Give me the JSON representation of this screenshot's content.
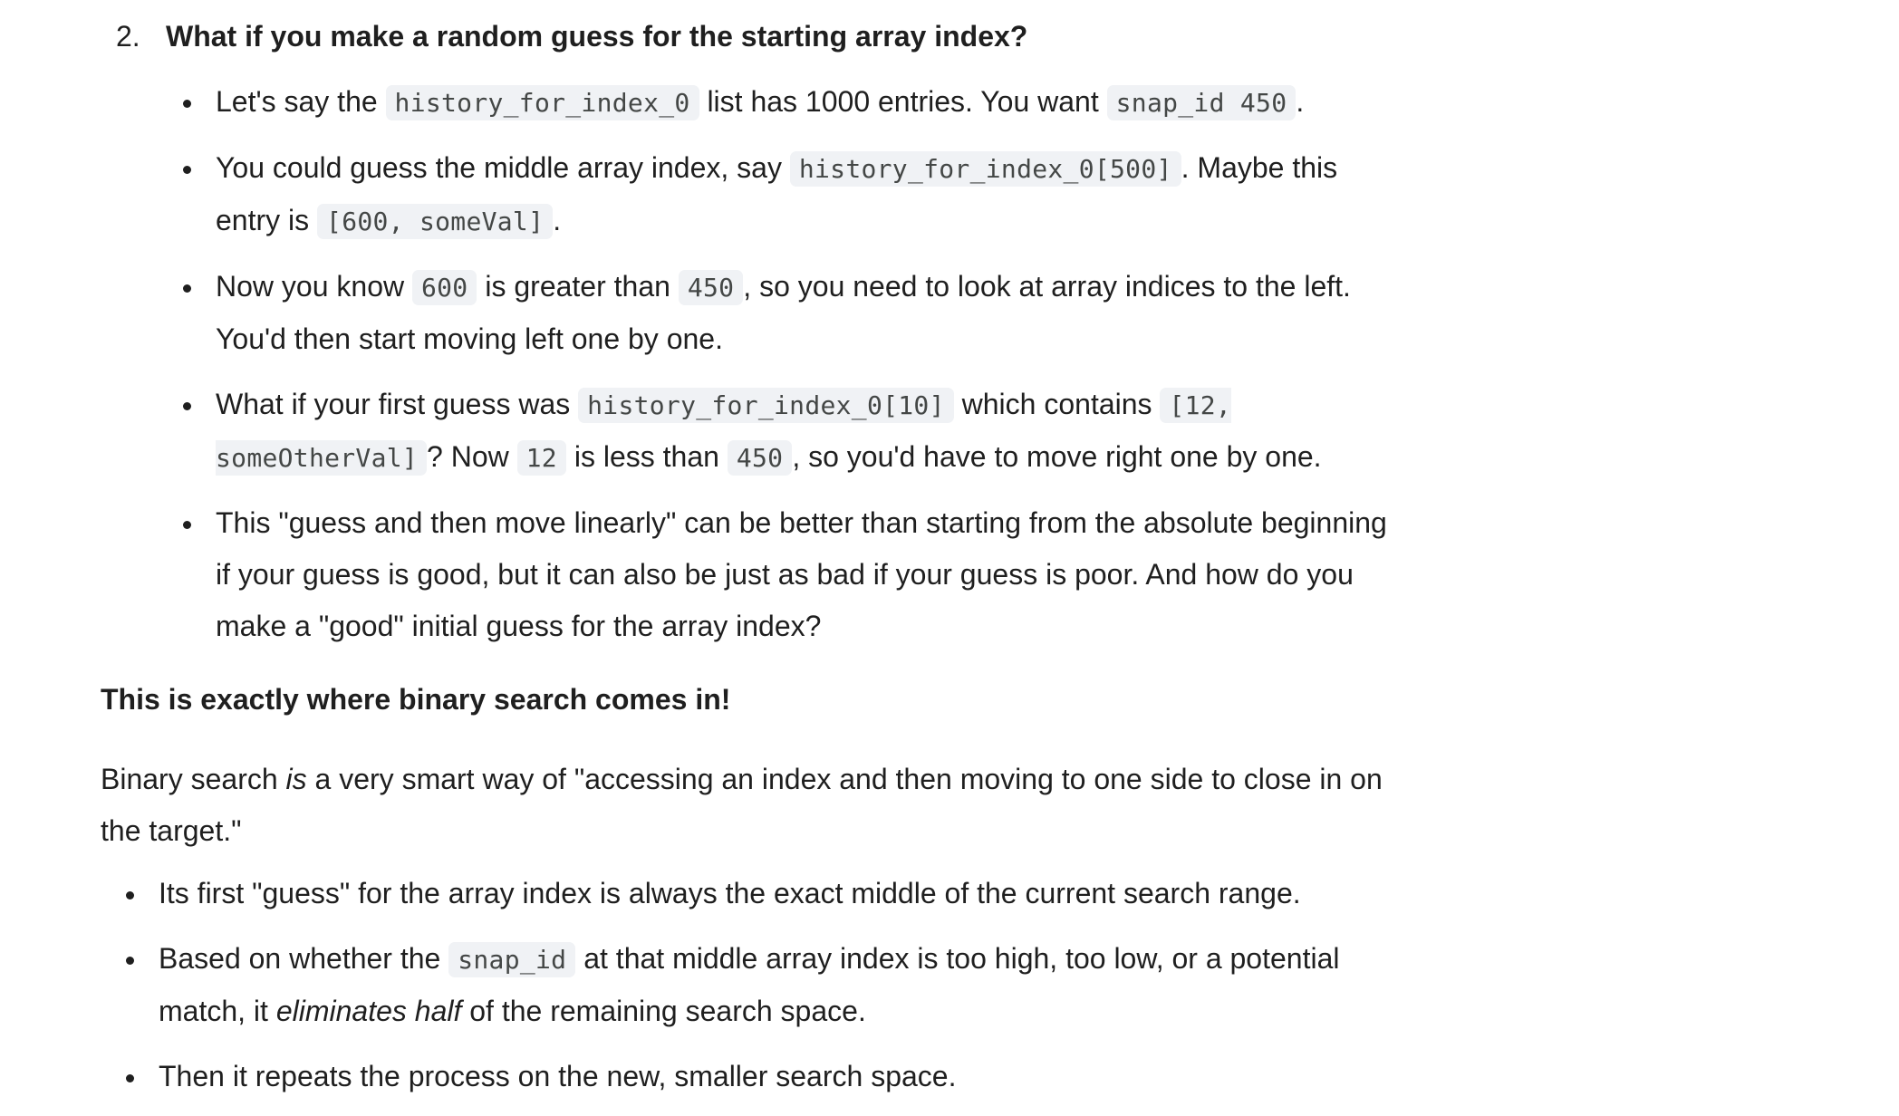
{
  "ordered_item": {
    "number": "2.",
    "heading": "What if you make a random guess for the starting array index?"
  },
  "list_a": {
    "b1": {
      "t1": "Let's say the ",
      "c1": "history_for_index_0",
      "t2": " list has 1000 entries. You want ",
      "c2": "snap_id 450",
      "t3": "."
    },
    "b2": {
      "t1": "You could guess the middle array index, say ",
      "c1": "history_for_index_0[500]",
      "t2": ". Maybe this entry is ",
      "c2": "[600, someVal]",
      "t3": "."
    },
    "b3": {
      "t1": "Now you know ",
      "c1": "600",
      "t2": " is greater than ",
      "c2": "450",
      "t3": ", so you need to look at array indices to the left. You'd then start moving left one by one."
    },
    "b4": {
      "t1": "What if your first guess was ",
      "c1": "history_for_index_0[10]",
      "t2": " which contains ",
      "c2": "[12, someOtherVal]",
      "t3": "? Now ",
      "c3": "12",
      "t4": " is less than ",
      "c4": "450",
      "t5": ", so you'd have to move right one by one."
    },
    "b5": {
      "t1": "This \"guess and then move linearly\" can be better than starting from the absolute beginning if your guess is good, but it can also be just as bad if your guess is poor. And how do you make a \"good\" initial guess for the array index?"
    }
  },
  "strong_para": "This is exactly where binary search comes in!",
  "para": {
    "t1": "Binary search ",
    "em1": "is",
    "t2": " a very smart way of \"accessing an index and then moving to one side to close in on the target.\""
  },
  "list_b": {
    "b1": {
      "t1": "Its first \"guess\" for the array index is always the exact middle of the current search range."
    },
    "b2": {
      "t1": "Based on whether the ",
      "c1": "snap_id",
      "t2": " at that middle array index is too high, too low, or a potential match, it ",
      "em1": "eliminates half",
      "t3": " of the remaining search space."
    },
    "b3": {
      "t1": "Then it repeats the process on the new, smaller search space."
    }
  }
}
